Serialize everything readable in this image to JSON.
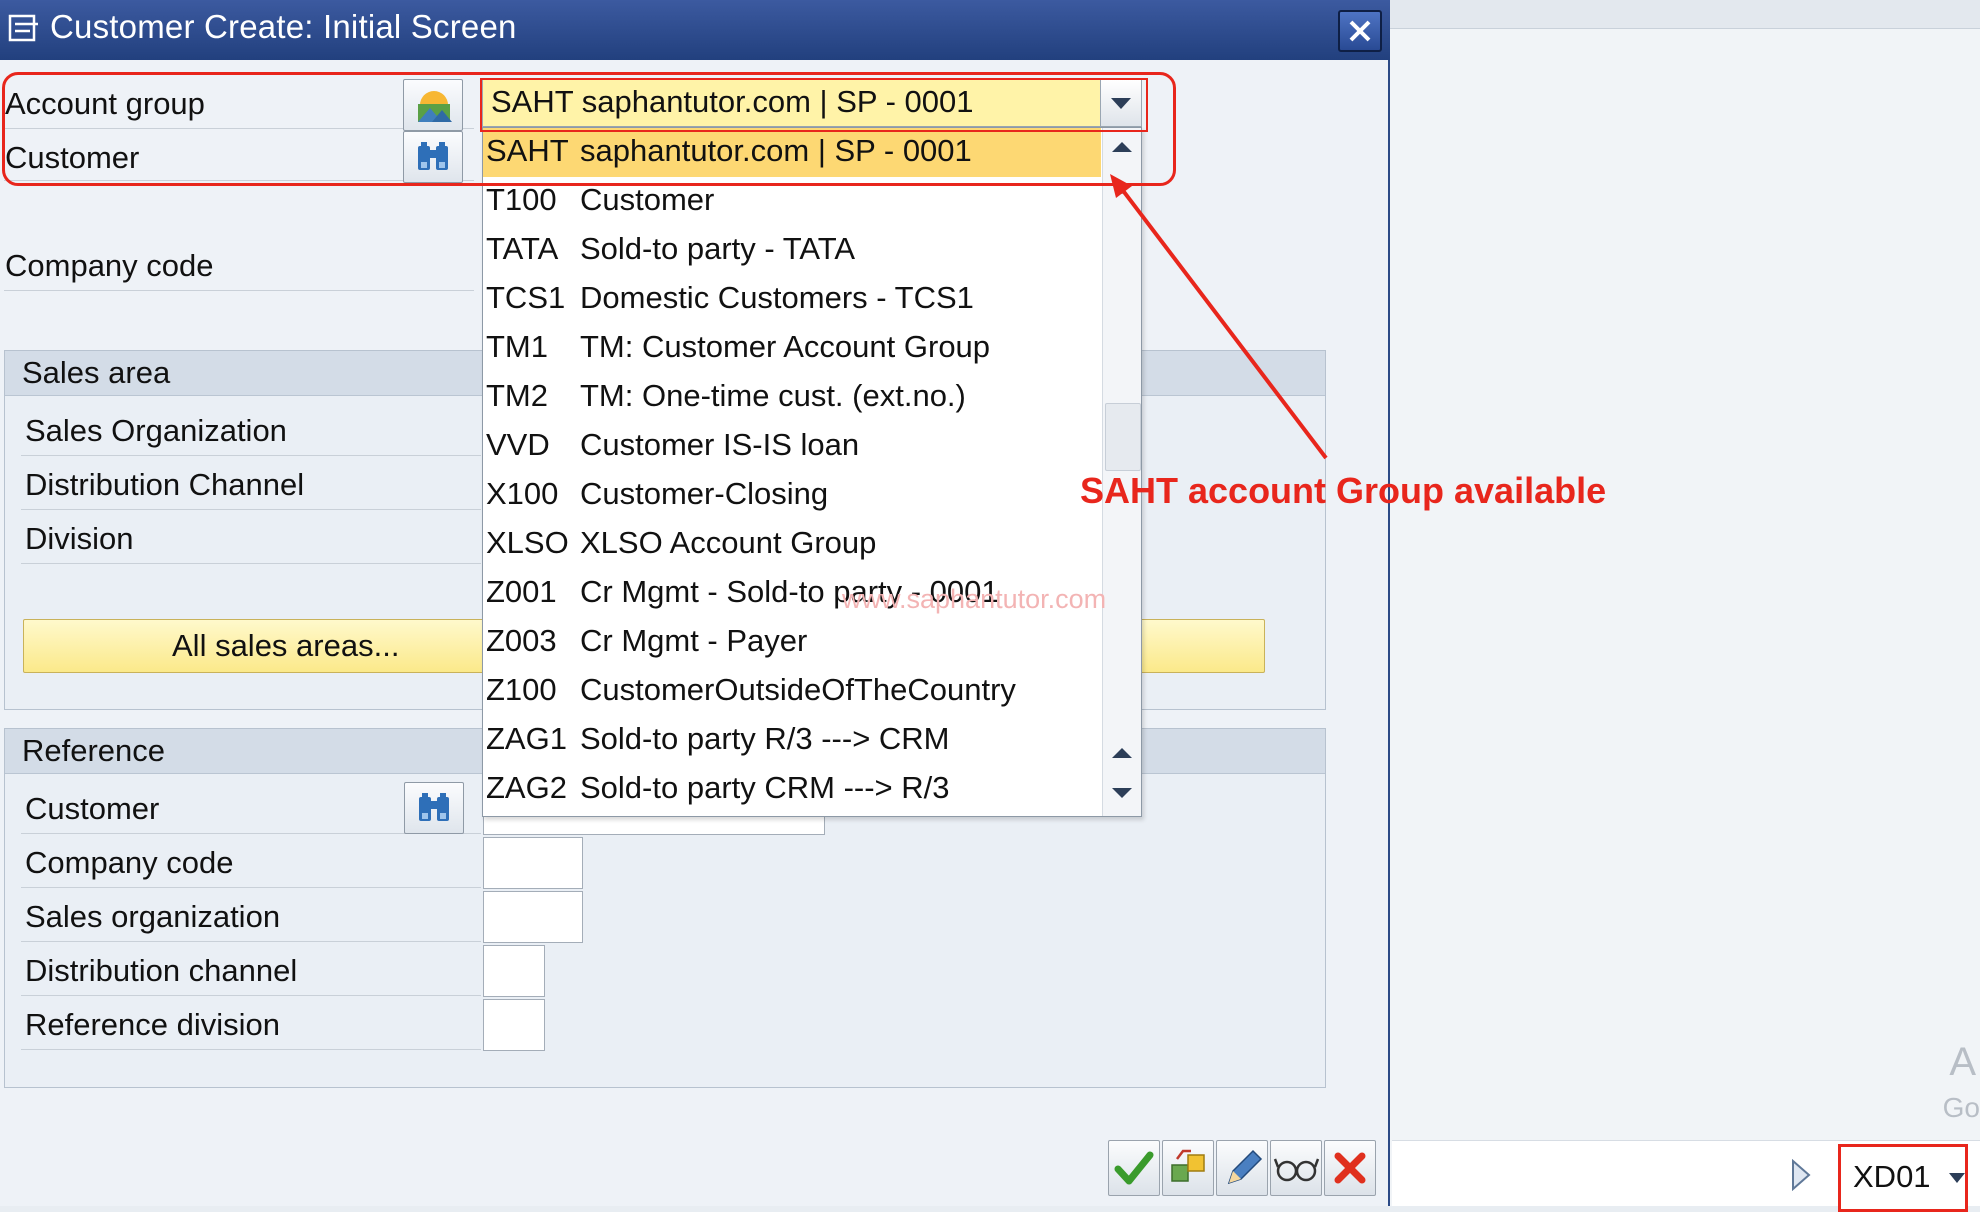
{
  "window": {
    "title": "Customer Create: Initial Screen"
  },
  "fields": {
    "account_group": "Account group",
    "customer": "Customer",
    "company_code": "Company code"
  },
  "account_group_value": "SAHT saphantutor.com | SP - 0001",
  "dropdown": {
    "selected": {
      "key": "SAHT",
      "text": "saphantutor.com | SP - 0001"
    },
    "items": [
      {
        "key": "T100",
        "text": "Customer"
      },
      {
        "key": "TATA",
        "text": "Sold-to party - TATA"
      },
      {
        "key": "TCS1",
        "text": "Domestic Customers - TCS1"
      },
      {
        "key": "TM1",
        "text": "TM: Customer Account Group"
      },
      {
        "key": "TM2",
        "text": "TM: One-time cust. (ext.no.)"
      },
      {
        "key": "VVD",
        "text": "Customer IS-IS loan"
      },
      {
        "key": "X100",
        "text": "Customer-Closing"
      },
      {
        "key": "XLSO",
        "text": "XLSO Account Group"
      },
      {
        "key": "Z001",
        "text": "Cr Mgmt - Sold-to party - 0001"
      },
      {
        "key": "Z003",
        "text": "Cr Mgmt - Payer"
      },
      {
        "key": "Z100",
        "text": "CustomerOutsideOfTheCountry"
      },
      {
        "key": "ZAG1",
        "text": "Sold-to party R/3 ---> CRM"
      },
      {
        "key": "ZAG2",
        "text": "Sold-to party CRM ---> R/3"
      }
    ]
  },
  "sales_area": {
    "title": "Sales area",
    "sales_organization": "Sales Organization",
    "distribution_channel": "Distribution Channel",
    "division": "Division",
    "all_sales_areas_button": "All sales areas..."
  },
  "reference": {
    "title": "Reference",
    "customer": "Customer",
    "company_code": "Company code",
    "sales_organization": "Sales organization",
    "distribution_channel": "Distribution channel",
    "reference_division": "Reference division"
  },
  "annotation": "SAHT account Group available",
  "watermark": "www.saphantutor.com",
  "tcode": "XD01",
  "colors": {
    "title_bar": "#2b4a8e",
    "highlight": "#e8261c",
    "selected_row": "#fdd873",
    "input_yellow": "#fff3a8"
  },
  "icons": [
    "dialog-icon",
    "close-icon",
    "account-group-f4-icon",
    "binoculars-icon",
    "scroll-up-icon",
    "scroll-down-icon",
    "checkmark-icon",
    "other-object-icon",
    "edit-pencil-icon",
    "glasses-icon",
    "cancel-x-icon",
    "play-arrow-icon",
    "tcode-dropdown-icon"
  ]
}
